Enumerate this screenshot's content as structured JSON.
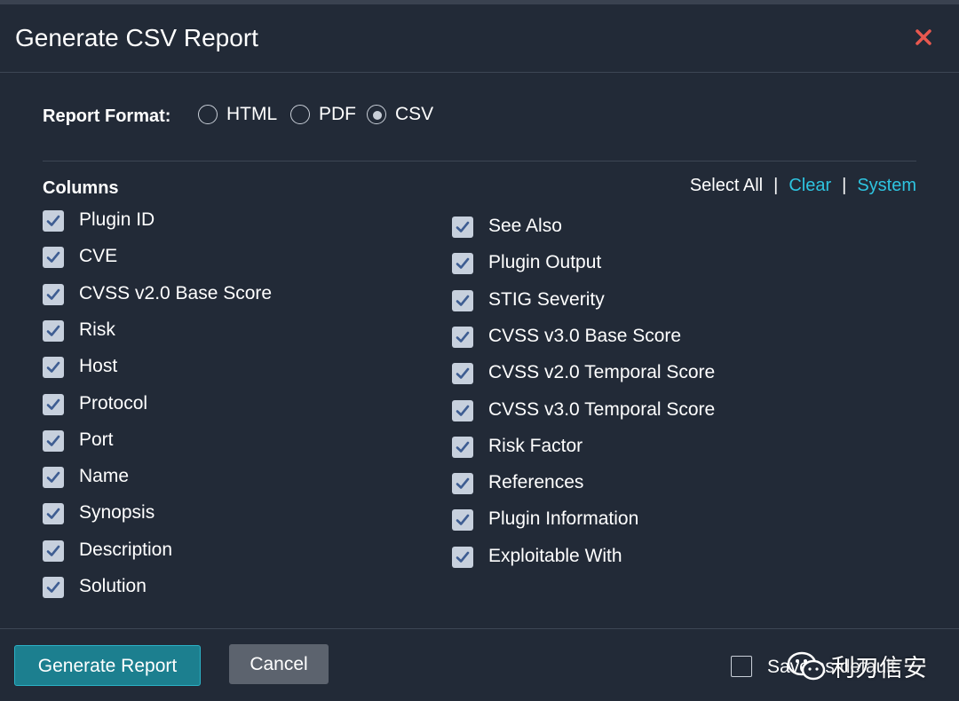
{
  "dialog": {
    "title": "Generate CSV Report"
  },
  "report_format": {
    "label": "Report Format:",
    "options": [
      {
        "label": "HTML",
        "selected": false
      },
      {
        "label": "PDF",
        "selected": false
      },
      {
        "label": "CSV",
        "selected": true
      }
    ]
  },
  "columns": {
    "title": "Columns",
    "actions": {
      "select_all": "Select All",
      "separator": "|",
      "clear": "Clear",
      "system": "System"
    },
    "left": [
      {
        "label": "Plugin ID",
        "checked": true
      },
      {
        "label": "CVE",
        "checked": true
      },
      {
        "label": "CVSS v2.0 Base Score",
        "checked": true
      },
      {
        "label": "Risk",
        "checked": true
      },
      {
        "label": "Host",
        "checked": true
      },
      {
        "label": "Protocol",
        "checked": true
      },
      {
        "label": "Port",
        "checked": true
      },
      {
        "label": "Name",
        "checked": true
      },
      {
        "label": "Synopsis",
        "checked": true
      },
      {
        "label": "Description",
        "checked": true
      },
      {
        "label": "Solution",
        "checked": true
      }
    ],
    "right": [
      {
        "label": "See Also",
        "checked": true
      },
      {
        "label": "Plugin Output",
        "checked": true
      },
      {
        "label": "STIG Severity",
        "checked": true
      },
      {
        "label": "CVSS v3.0 Base Score",
        "checked": true
      },
      {
        "label": "CVSS v2.0 Temporal Score",
        "checked": true
      },
      {
        "label": "CVSS v3.0 Temporal Score",
        "checked": true
      },
      {
        "label": "Risk Factor",
        "checked": true
      },
      {
        "label": "References",
        "checked": true
      },
      {
        "label": "Plugin Information",
        "checked": true
      },
      {
        "label": "Exploitable With",
        "checked": true
      }
    ]
  },
  "footer": {
    "generate_label": "Generate Report",
    "cancel_label": "Cancel",
    "save_default_label": "Save as default",
    "save_default_checked": false
  },
  "watermark": {
    "text": "利刃信安"
  },
  "colors": {
    "background": "#222a37",
    "accent_link": "#2ec4e0",
    "primary_button": "#1c7f8f",
    "close_icon": "#e8584f",
    "checkbox_fill": "#c7d0dd",
    "checkmark": "#3e5d92"
  },
  "icons": {
    "close": "close-icon",
    "check": "checkmark-icon",
    "wechat": "wechat-icon"
  }
}
